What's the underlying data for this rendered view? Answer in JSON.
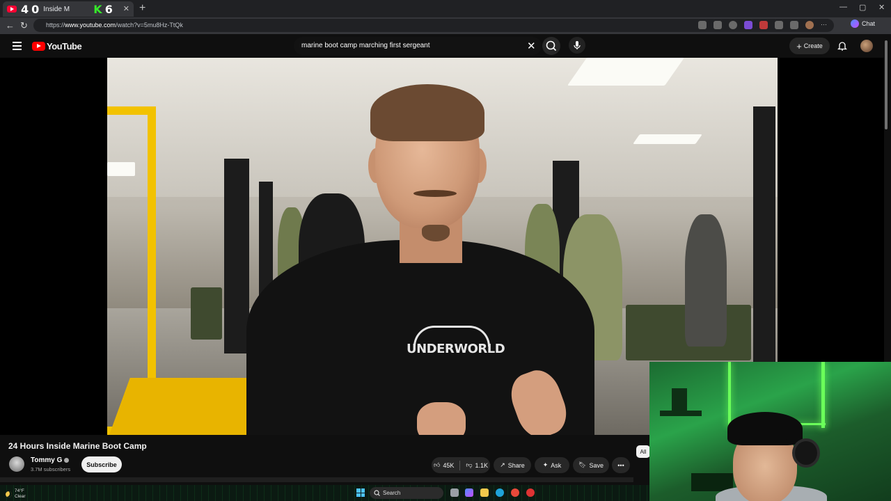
{
  "browser": {
    "tab_title": "Inside M",
    "overlay_digits": [
      "4",
      "0",
      "6"
    ],
    "overlay_letter": "K",
    "url_prefix": "https://",
    "url_host": "www.youtube.com",
    "url_path": "/watch?v=5mu8Hz-TtQk",
    "chat_label": "Chat"
  },
  "youtube": {
    "logo_text": "YouTube",
    "search_value": "marine boot camp marching first sergeant",
    "create_label": "Create"
  },
  "video": {
    "title": "24 Hours Inside Marine Boot Camp",
    "shirt_text": "UNDERWORLD",
    "channel_name": "Tommy G",
    "subscribers": "3.7M subscribers",
    "subscribe_label": "Subscribe",
    "likes": "45K",
    "dislikes": "1.1K",
    "share_label": "Share",
    "ask_label": "Ask",
    "save_label": "Save",
    "more_label": "•••",
    "all_chip": "All"
  },
  "taskbar": {
    "temperature": "74°F",
    "condition": "Clear",
    "search_label": "Search"
  },
  "colors": {
    "yt_red": "#ff0000",
    "background": "#0f0f0f",
    "webcam_green": "#2aa34a"
  }
}
